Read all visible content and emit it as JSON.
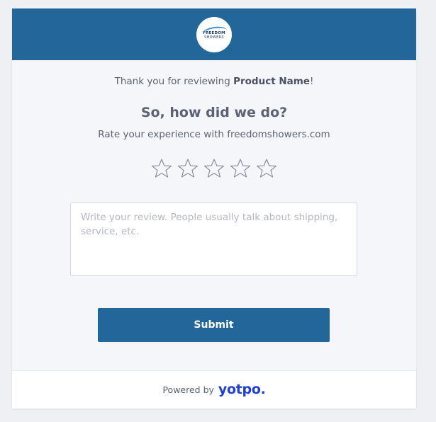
{
  "brand": {
    "logo_top": "FREEDOM",
    "logo_bottom": "SHOWERS",
    "header_color": "#23679a"
  },
  "intro": {
    "prefix": "Thank you for reviewing ",
    "product": "Product Name",
    "suffix": "!"
  },
  "heading": "So, how did we do?",
  "subtitle": "Rate your experience with freedomshowers.com",
  "rating": {
    "max": 5,
    "selected": 0,
    "icon": "star-outline-icon",
    "star_color": "#7d8799"
  },
  "review": {
    "value": "",
    "placeholder": "Write your review. People usually talk about shipping, service, etc."
  },
  "submit_label": "Submit",
  "footer": {
    "powered_by": "Powered by",
    "brand": "yotpo.",
    "brand_color": "#1f3fd1"
  }
}
